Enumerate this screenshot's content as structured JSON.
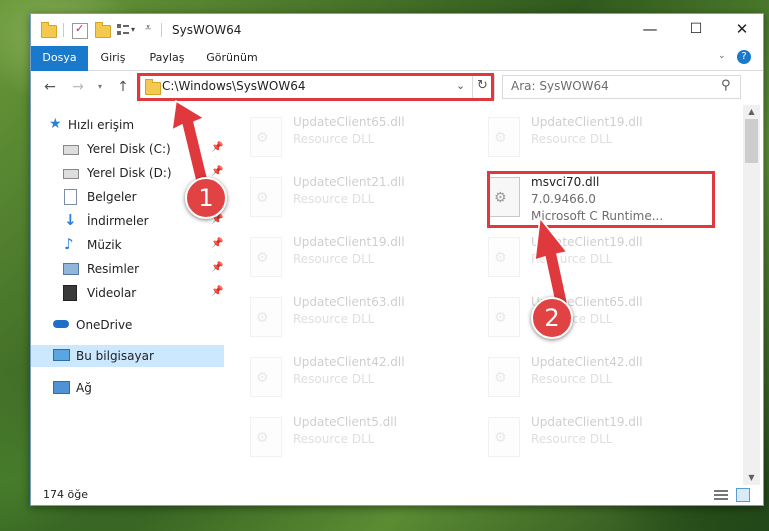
{
  "window": {
    "title": "SysWOW64",
    "controls": {
      "minimize": "—",
      "maximize": "☐",
      "close": "✕"
    }
  },
  "ribbon": {
    "tabs": [
      {
        "label": "Dosya",
        "active": true
      },
      {
        "label": "Giriş"
      },
      {
        "label": "Paylaş"
      },
      {
        "label": "Görünüm"
      }
    ],
    "help": "?"
  },
  "address_bar": {
    "path": "C:\\Windows\\SysWOW64"
  },
  "search": {
    "placeholder": "Ara: SysWOW64"
  },
  "nav_pane": {
    "items": [
      {
        "label": "Hızlı erişim",
        "icon": "star-icon"
      },
      {
        "label": "Yerel Disk (C:)",
        "icon": "drive-icon",
        "pinned": true
      },
      {
        "label": "Yerel Disk (D:)",
        "icon": "drive-icon",
        "pinned": true
      },
      {
        "label": "Belgeler",
        "icon": "documents-icon",
        "pinned": true
      },
      {
        "label": "İndirmeler",
        "icon": "download-icon",
        "pinned": true
      },
      {
        "label": "Müzik",
        "icon": "music-icon",
        "pinned": true
      },
      {
        "label": "Resimler",
        "icon": "pictures-icon",
        "pinned": true
      },
      {
        "label": "Videolar",
        "icon": "videos-icon",
        "pinned": true
      },
      {
        "label": "OneDrive",
        "icon": "cloud-icon"
      },
      {
        "label": "Bu bilgisayar",
        "icon": "computer-icon",
        "selected": true
      },
      {
        "label": "Ağ",
        "icon": "network-icon"
      }
    ]
  },
  "files": [
    {
      "name": "UpdateClient65.dll",
      "sub": "Resource DLL"
    },
    {
      "name": "UpdateClient19.dll",
      "sub": "Resource DLL"
    },
    {
      "name": "UpdateClient21.dll",
      "sub": "Resource DLL"
    },
    {
      "name": "msvci70.dll",
      "sub": "7.0.9466.0",
      "sub2": "Microsoft C Runtime...",
      "highlighted": true
    },
    {
      "name": "UpdateClient19.dll",
      "sub": "Resource DLL"
    },
    {
      "name": "UpdateClient19.dll",
      "sub": "Resource DLL"
    },
    {
      "name": "UpdateClient63.dll",
      "sub": "Resource DLL"
    },
    {
      "name": "UpdateClient65.dll",
      "sub": "Resource DLL"
    },
    {
      "name": "UpdateClient42.dll",
      "sub": "Resource DLL"
    },
    {
      "name": "UpdateClient42.dll",
      "sub": "Resource DLL"
    },
    {
      "name": "UpdateClient5.dll",
      "sub": "Resource DLL"
    },
    {
      "name": "UpdateClient19.dll",
      "sub": "Resource DLL"
    }
  ],
  "status_bar": {
    "item_count": "174 öğe"
  },
  "annotations": {
    "step1": "1",
    "step2": "2",
    "color": "#e0393d"
  }
}
